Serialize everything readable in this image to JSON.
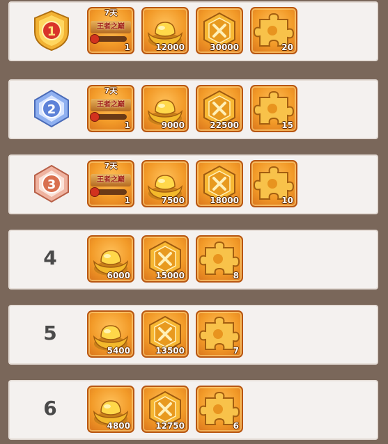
{
  "colors": {
    "background": "#7a675a",
    "row_bg": "#f4f1ef",
    "tile_orange": "#f29a28",
    "rank1_gold": "#f2b233",
    "rank2_blue": "#6f95e6",
    "rank3_copper": "#e07f63"
  },
  "rows": [
    {
      "rank_label": "1",
      "rank_badge": "gold-rank-1-badge-icon",
      "items": [
        {
          "icon": "title-card-icon",
          "days": "7天",
          "title": "王者之巅",
          "count": "1"
        },
        {
          "icon": "gold-ingot-icon",
          "count": "12000"
        },
        {
          "icon": "hexagon-coin-icon",
          "count": "30000"
        },
        {
          "icon": "puzzle-piece-icon",
          "count": "20"
        }
      ]
    },
    {
      "rank_label": "2",
      "rank_badge": "silver-rank-2-badge-icon",
      "items": [
        {
          "icon": "title-card-icon",
          "days": "7天",
          "title": "王者之巅",
          "count": "1"
        },
        {
          "icon": "gold-ingot-icon",
          "count": "9000"
        },
        {
          "icon": "hexagon-coin-icon",
          "count": "22500"
        },
        {
          "icon": "puzzle-piece-icon",
          "count": "15"
        }
      ]
    },
    {
      "rank_label": "3",
      "rank_badge": "bronze-rank-3-badge-icon",
      "items": [
        {
          "icon": "title-card-icon",
          "days": "7天",
          "title": "王者之巅",
          "count": "1"
        },
        {
          "icon": "gold-ingot-icon",
          "count": "7500"
        },
        {
          "icon": "hexagon-coin-icon",
          "count": "18000"
        },
        {
          "icon": "puzzle-piece-icon",
          "count": "10"
        }
      ]
    },
    {
      "rank_label": "4",
      "items": [
        {
          "icon": "gold-ingot-icon",
          "count": "6000"
        },
        {
          "icon": "hexagon-coin-icon",
          "count": "15000"
        },
        {
          "icon": "puzzle-piece-icon",
          "count": "8"
        }
      ]
    },
    {
      "rank_label": "5",
      "items": [
        {
          "icon": "gold-ingot-icon",
          "count": "5400"
        },
        {
          "icon": "hexagon-coin-icon",
          "count": "13500"
        },
        {
          "icon": "puzzle-piece-icon",
          "count": "7"
        }
      ]
    },
    {
      "rank_label": "6",
      "items": [
        {
          "icon": "gold-ingot-icon",
          "count": "4800"
        },
        {
          "icon": "hexagon-coin-icon",
          "count": "12750"
        },
        {
          "icon": "puzzle-piece-icon",
          "count": "6"
        }
      ]
    }
  ]
}
